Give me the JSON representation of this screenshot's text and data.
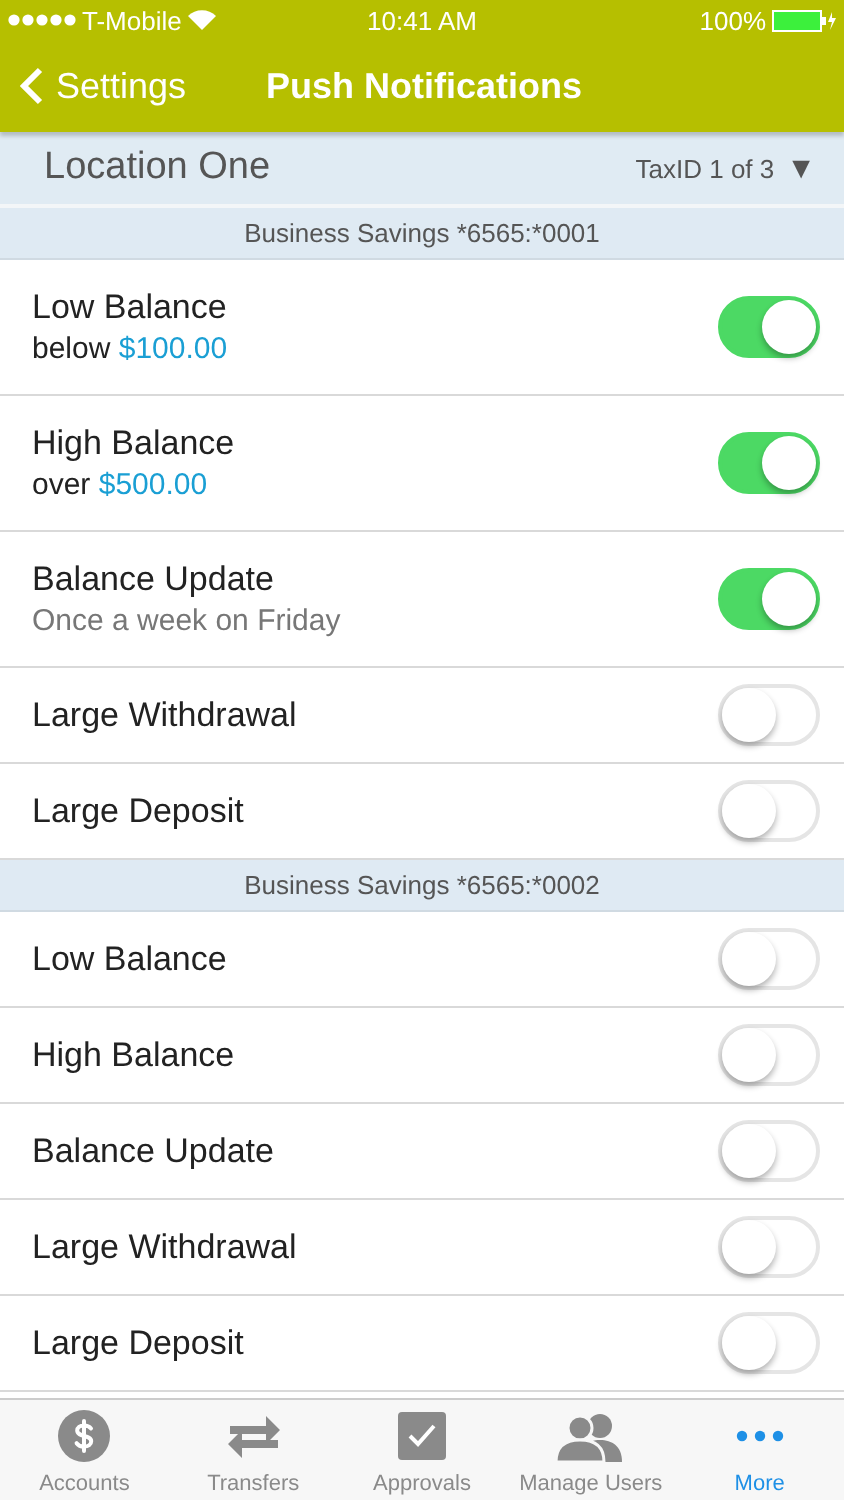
{
  "status_bar": {
    "carrier": "T-Mobile",
    "time": "10:41 AM",
    "battery": "100%"
  },
  "nav": {
    "back": "Settings",
    "title": "Push Notifications"
  },
  "location": {
    "name": "Location One",
    "taxid": "TaxID 1 of 3",
    "dropdown": "▼"
  },
  "sections": [
    {
      "title": "Business Savings *6565:*0001",
      "rows": [
        {
          "label": "Low Balance",
          "prefix": "below",
          "amount": "$100.00",
          "on": true
        },
        {
          "label": "High Balance",
          "prefix": "over",
          "amount": "$500.00",
          "on": true
        },
        {
          "label": "Balance Update",
          "subtitle": "Once a week on Friday",
          "on": true
        },
        {
          "label": "Large Withdrawal",
          "on": false
        },
        {
          "label": "Large Deposit",
          "on": false
        }
      ]
    },
    {
      "title": "Business Savings *6565:*0002",
      "rows": [
        {
          "label": "Low Balance",
          "on": false
        },
        {
          "label": "High Balance",
          "on": false
        },
        {
          "label": "Balance Update",
          "on": false
        },
        {
          "label": "Large Withdrawal",
          "on": false
        },
        {
          "label": "Large Deposit",
          "on": false
        }
      ]
    }
  ],
  "tabs": [
    {
      "label": "Accounts",
      "selected": false
    },
    {
      "label": "Transfers",
      "selected": false
    },
    {
      "label": "Approvals",
      "selected": false
    },
    {
      "label": "Manage Users",
      "selected": false
    },
    {
      "label": "More",
      "selected": true
    }
  ]
}
